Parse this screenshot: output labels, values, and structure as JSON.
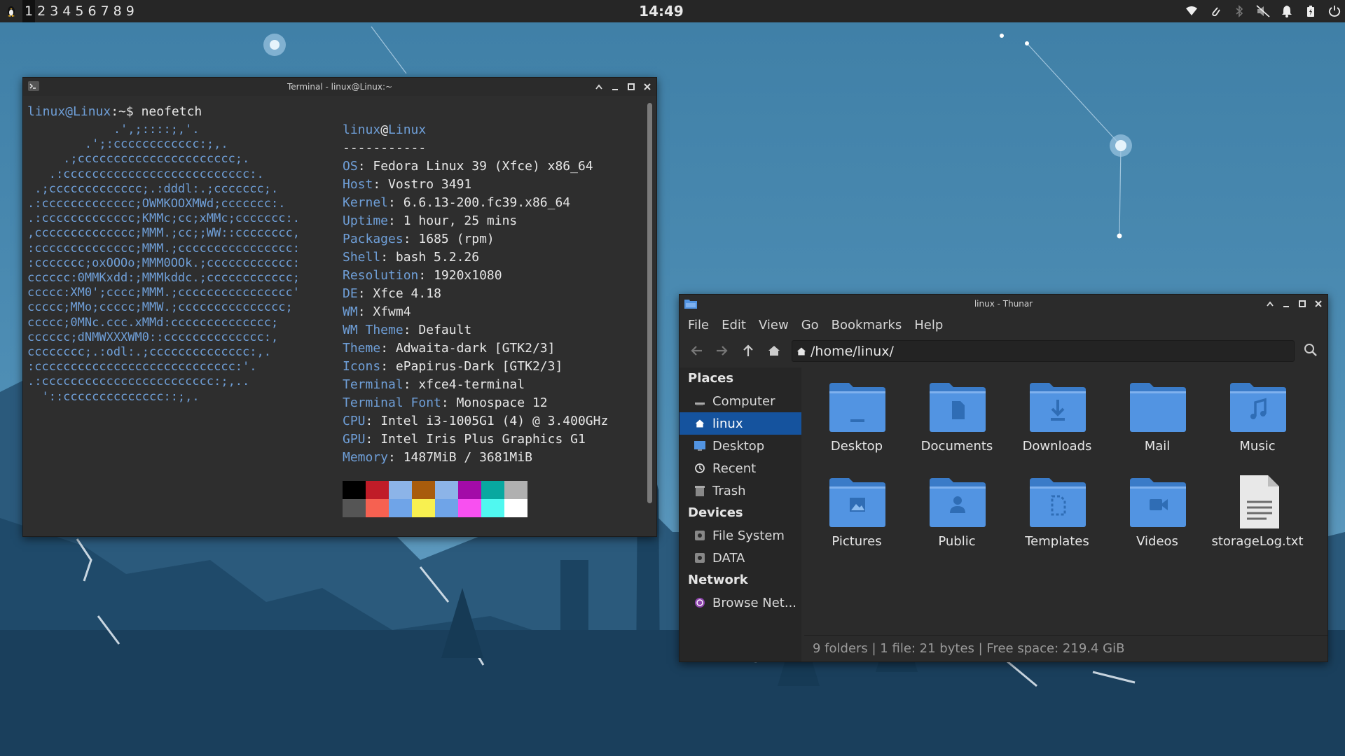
{
  "panel": {
    "workspaces": [
      "1",
      "2",
      "3",
      "4",
      "5",
      "6",
      "7",
      "8",
      "9"
    ],
    "active_workspace": "1",
    "clock": "14:49",
    "tray_icons": [
      "wifi-icon",
      "paperclip-icon",
      "bluetooth-icon",
      "volume-muted-icon",
      "notification-bell-icon",
      "battery-icon",
      "power-icon"
    ]
  },
  "terminal": {
    "title": "Terminal - linux@Linux:~",
    "prompt_user": "linux@Linux",
    "prompt_rest": ":~$ neofetch",
    "logo_lines": [
      "            .',;::::;,'.",
      "        .';:cccccccccccc:;,.",
      "     .;cccccccccccccccccccccc;.",
      "   .:cccccccccccccccccccccccccc:.",
      " .;ccccccccccccc;.:dddl:.;ccccccc;.",
      ".:ccccccccccccc;OWMKOOXMWd;ccccccc:.",
      ".:ccccccccccccc;KMMc;cc;xMMc;ccccccc:.",
      ",cccccccccccccc;MMM.;cc;;WW::cccccccc,",
      ":cccccccccccccc;MMM.;cccccccccccccccc:",
      ":ccccccc;oxOOOo;MMM0OOk.;cccccccccccc:",
      "cccccc:0MMKxdd:;MMMkddc.;cccccccccccc;",
      "ccccc:XM0';cccc;MMM.;cccccccccccccccc'",
      "ccccc;MMo;ccccc;MMW.;ccccccccccccccc;",
      "ccccc;0MNc.ccc.xMMd:cccccccccccccc;",
      "cccccc;dNMWXXXWM0::cccccccccccccc:,",
      "cccccccc;.:odl:.;cccccccccccccc:,.",
      ":cccccccccccccccccccccccccccc:'.",
      ".:cccccccccccccccccccccccc:;,..",
      "  '::cccccccccccccc::;,."
    ],
    "user_host": {
      "user": "linux",
      "at": "@",
      "host": "Linux"
    },
    "separator": "-----------",
    "info": [
      {
        "key": "OS",
        "value": "Fedora Linux 39 (Xfce) x86_64"
      },
      {
        "key": "Host",
        "value": "Vostro 3491"
      },
      {
        "key": "Kernel",
        "value": "6.6.13-200.fc39.x86_64"
      },
      {
        "key": "Uptime",
        "value": "1 hour, 25 mins"
      },
      {
        "key": "Packages",
        "value": "1685 (rpm)"
      },
      {
        "key": "Shell",
        "value": "bash 5.2.26"
      },
      {
        "key": "Resolution",
        "value": "1920x1080"
      },
      {
        "key": "DE",
        "value": "Xfce 4.18"
      },
      {
        "key": "WM",
        "value": "Xfwm4"
      },
      {
        "key": "WM Theme",
        "value": "Default"
      },
      {
        "key": "Theme",
        "value": "Adwaita-dark [GTK2/3]"
      },
      {
        "key": "Icons",
        "value": "ePapirus-Dark [GTK2/3]"
      },
      {
        "key": "Terminal",
        "value": "xfce4-terminal"
      },
      {
        "key": "Terminal Font",
        "value": "Monospace 12"
      },
      {
        "key": "CPU",
        "value": "Intel i3-1005G1 (4) @ 3.400GHz"
      },
      {
        "key": "GPU",
        "value": "Intel Iris Plus Graphics G1"
      },
      {
        "key": "Memory",
        "value": "1487MiB / 3681MiB"
      }
    ],
    "palette_top": [
      "#000000",
      "#c01c28",
      "#8cb4e8",
      "#a85c0c",
      "#8cb4e8",
      "#a30ba8",
      "#08a8a0",
      "#b0b0b0"
    ],
    "palette_bottom": [
      "#555555",
      "#f66151",
      "#6fa4e8",
      "#f8f050",
      "#6fa4e8",
      "#f850f0",
      "#50f8f0",
      "#ffffff"
    ]
  },
  "thunar": {
    "title": "linux - Thunar",
    "menu": [
      "File",
      "Edit",
      "View",
      "Go",
      "Bookmarks",
      "Help"
    ],
    "path": "/home/linux/",
    "sidebar": {
      "places_label": "Places",
      "places": [
        {
          "label": "Computer",
          "icon": "computer-icon"
        },
        {
          "label": "linux",
          "icon": "home-icon"
        },
        {
          "label": "Desktop",
          "icon": "desktop-icon"
        },
        {
          "label": "Recent",
          "icon": "recent-clock-icon"
        },
        {
          "label": "Trash",
          "icon": "trash-icon"
        }
      ],
      "devices_label": "Devices",
      "devices": [
        {
          "label": "File System",
          "icon": "drive-icon"
        },
        {
          "label": "DATA",
          "icon": "drive-icon"
        }
      ],
      "network_label": "Network",
      "network": [
        {
          "label": "Browse Net...",
          "icon": "network-globe-icon"
        }
      ]
    },
    "files": [
      {
        "name": "Desktop",
        "icon": "folder-desktop-icon"
      },
      {
        "name": "Documents",
        "icon": "folder-documents-icon"
      },
      {
        "name": "Downloads",
        "icon": "folder-downloads-icon"
      },
      {
        "name": "Mail",
        "icon": "folder-mail-icon"
      },
      {
        "name": "Music",
        "icon": "folder-music-icon"
      },
      {
        "name": "Pictures",
        "icon": "folder-pictures-icon"
      },
      {
        "name": "Public",
        "icon": "folder-public-icon"
      },
      {
        "name": "Templates",
        "icon": "folder-templates-icon"
      },
      {
        "name": "Videos",
        "icon": "folder-videos-icon"
      },
      {
        "name": "storageLog.txt",
        "icon": "text-file-icon"
      }
    ],
    "status": "9 folders  |  1 file: 21 bytes  |  Free space: 219.4 GiB"
  },
  "colors": {
    "accent": "#15539e",
    "folder": "#5294e2",
    "terminal_key": "#6f9fd8"
  }
}
